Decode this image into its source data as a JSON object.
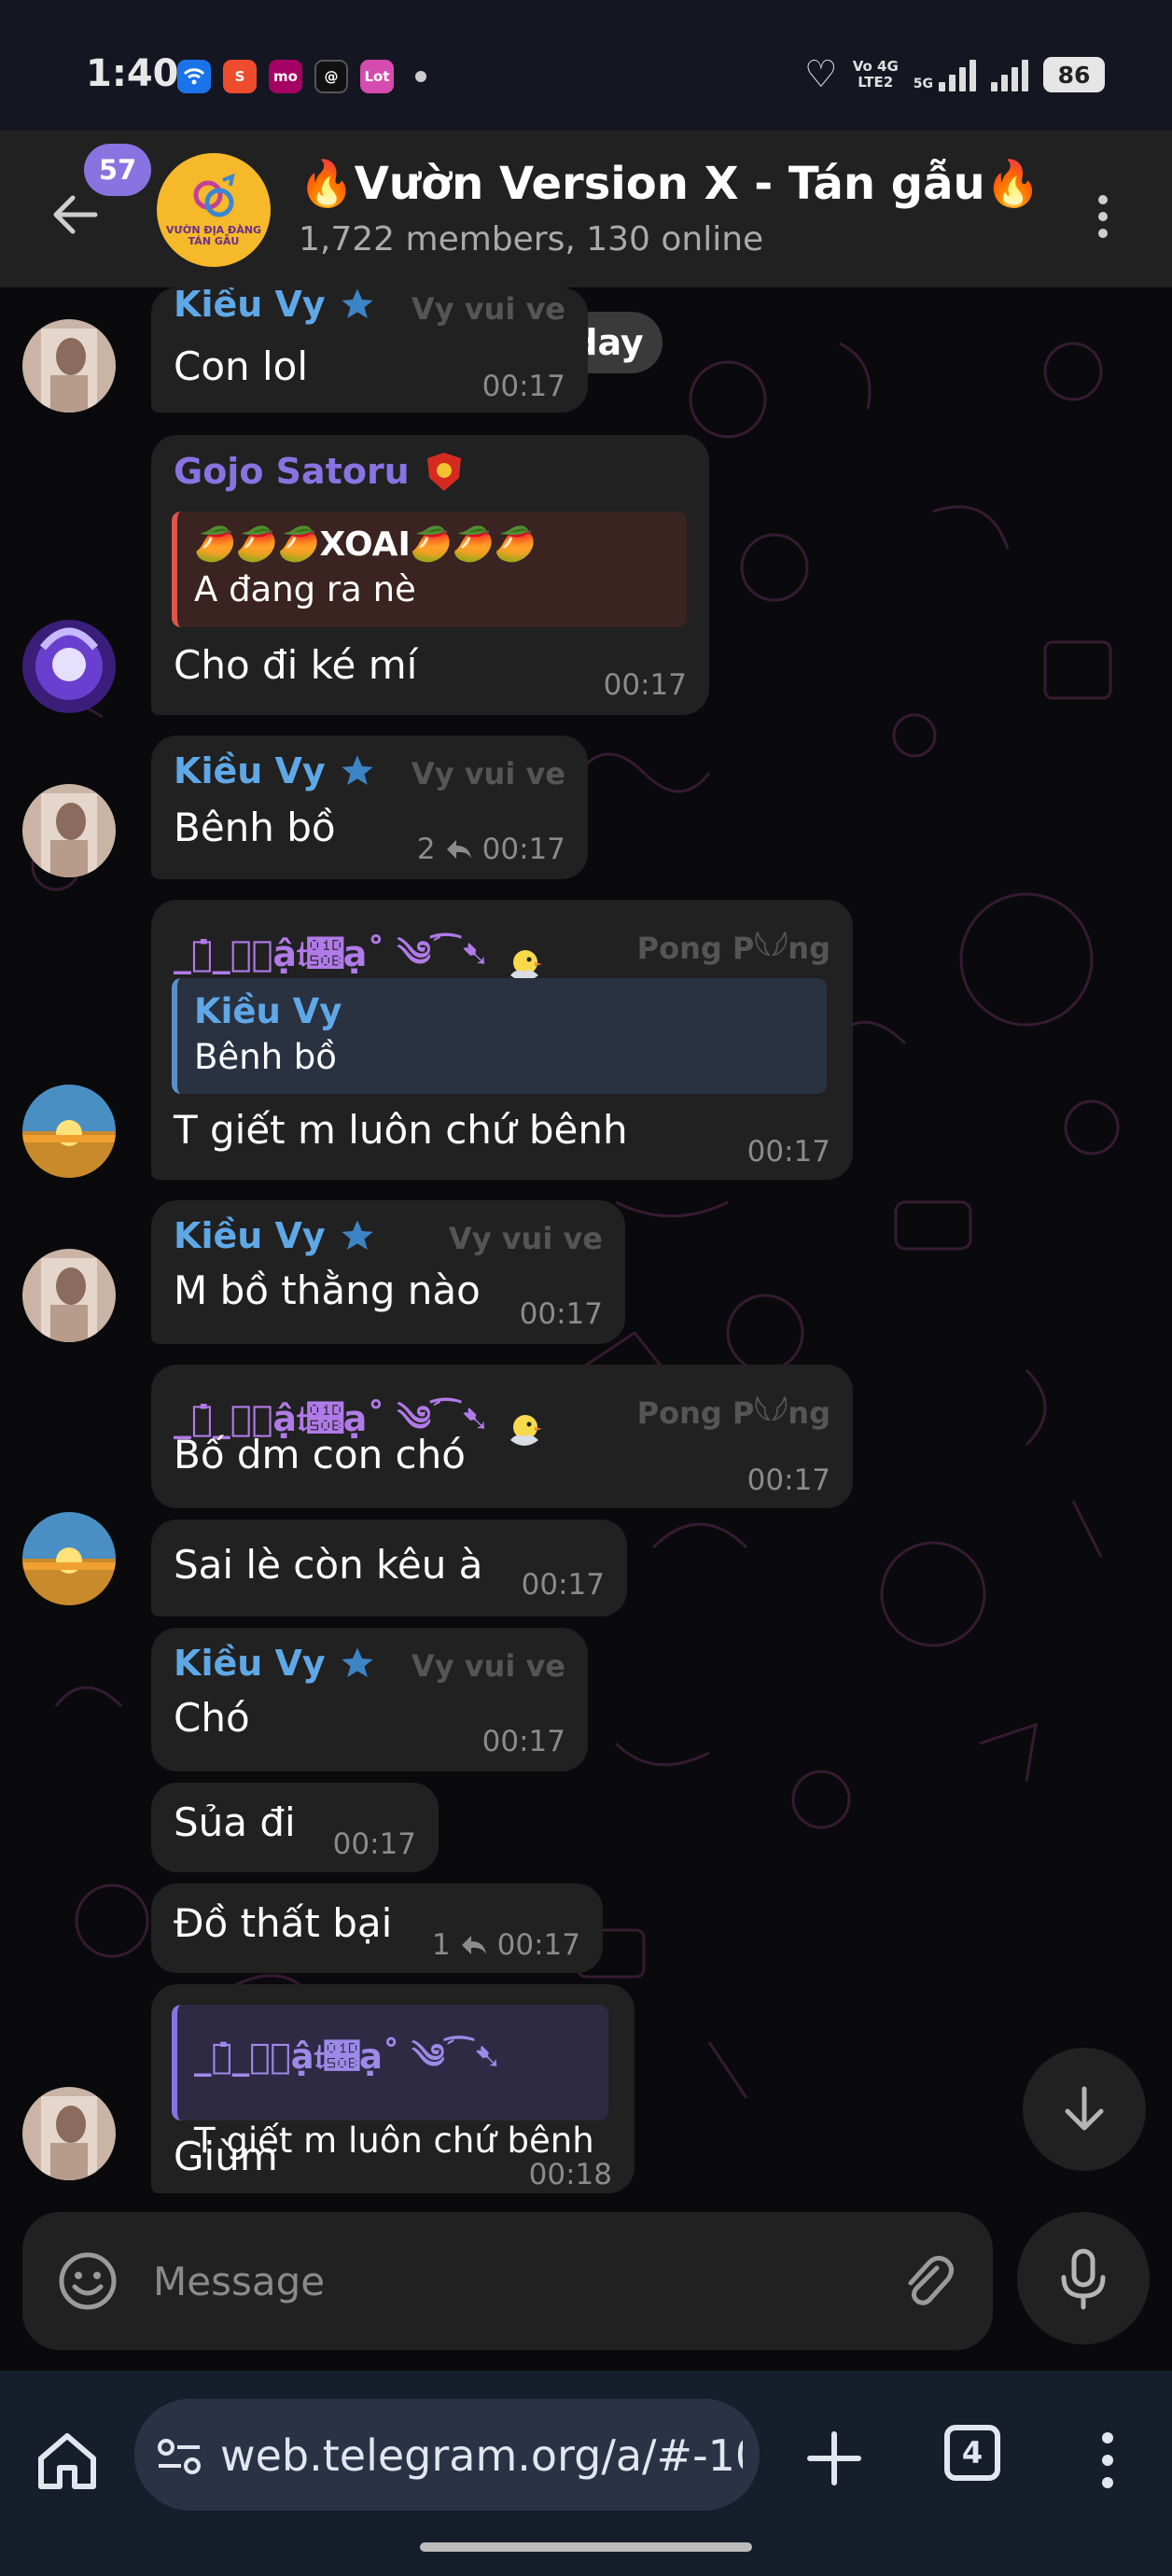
{
  "status_bar": {
    "time": "1:40",
    "apps": [
      {
        "icon": "wifi-app-icon",
        "text": "",
        "color": "#1a73e8"
      },
      {
        "icon": "shopee-icon",
        "text": "S",
        "color": "#ee4d2d"
      },
      {
        "icon": "momo-icon",
        "text": "mo",
        "color": "#a50064"
      },
      {
        "icon": "threads-icon",
        "text": "@",
        "color": "#111111"
      },
      {
        "icon": "lot-icon",
        "text": "Lot",
        "color": "#d64bb0"
      }
    ],
    "network": "Vo 4G\nLTE2",
    "network_5g": "5G",
    "battery": "86"
  },
  "header": {
    "unread_badge": "57",
    "avatar_text": "VƯỜN ĐỊA ĐÀNG\nTÁN GẪU",
    "title": "🔥Vườn Version X - Tán gẫu🔥",
    "subtitle": "1,722 members, 130 online"
  },
  "chat": {
    "date_label": "Today",
    "messages": [
      {
        "sender": "Kiều Vy",
        "rank": "Vy vui ve",
        "text": "Con lol",
        "time": "00:17"
      },
      {
        "sender": "Gojo Satoru",
        "quote_title": "🥭🥭🥭XOAI🥭🥭🥭",
        "quote_text": "A đang ra nè",
        "text": "Cho đi ké mí",
        "time": "00:17"
      },
      {
        "sender": "Kiều Vy",
        "rank": "Vy vui ve",
        "text": "Bênh bồ",
        "replies": "2",
        "time": "00:17"
      },
      {
        "sender": "_ஜ̇_𝔑𝔥ậ𝔱𝔋ạ˚ ༄ؘ⁀➷",
        "rank": "Pong P𓆩𓆪ng",
        "quote_name": "Kiều Vy",
        "quote_text": "Bênh bồ",
        "text": "T giết m luôn chứ bênh",
        "time": "00:17"
      },
      {
        "sender": "Kiều Vy",
        "rank": "Vy vui ve",
        "text": "M bồ thằng nào",
        "time": "00:17"
      },
      {
        "sender": "_ஜ̇_𝔑𝔥ậ𝔱𝔋ạ˚ ༄ؘ⁀➷",
        "rank": "Pong P𓆩𓆪ng",
        "text": "Bố dm con chó",
        "time": "00:17"
      },
      {
        "text": "Sai lè còn kêu à",
        "time": "00:17"
      },
      {
        "sender": "Kiều Vy",
        "rank": "Vy vui ve",
        "text": "Chó",
        "time": "00:17"
      },
      {
        "text": "Sủa đi",
        "time": "00:17"
      },
      {
        "text": "Đồ thất bại",
        "replies": "1",
        "time": "00:17"
      },
      {
        "quote_name": "_ஜ̇_𝔑𝔥ậ𝔱𝔋ạ˚ ༄ؘ⁀➷",
        "quote_text": "T giết m luôn chứ bênh",
        "text": "Giùm",
        "time": "00:18"
      }
    ]
  },
  "composer": {
    "placeholder": "Message"
  },
  "browser": {
    "url": "web.telegram.org/a/#-100",
    "tab_count": "4"
  },
  "colors": {
    "kieu_vy": "#5fa8e8",
    "gojo": "#8774e1",
    "nhatha": "#b07ae8",
    "quote_kieu": "#5a8ec8",
    "quote_gojo": "#e0554b",
    "quote_nhatha": "#8774e1"
  }
}
